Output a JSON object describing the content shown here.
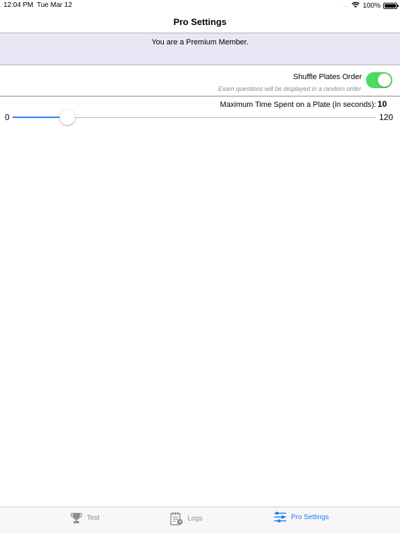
{
  "status_bar": {
    "time": "12:04 PM",
    "date": "Tue Mar 12",
    "battery_percent": "100%",
    "battery_level": 1.0
  },
  "nav": {
    "title": "Pro Settings"
  },
  "premium": {
    "message": "You are a Premium Member."
  },
  "shuffle": {
    "label": "Shuffle Plates Order",
    "hint": "Exam questions will be displayed in a random order",
    "enabled": true
  },
  "time_slider": {
    "label": "Maximum Time Spent on a Plate (in seconds):",
    "value": "10",
    "min": "0",
    "max": "120"
  },
  "tabs": [
    {
      "label": "Test",
      "icon": "trophy-icon",
      "active": false
    },
    {
      "label": "Logs",
      "icon": "logs-icon",
      "active": false
    },
    {
      "label": "Pro Settings",
      "icon": "sliders-icon",
      "active": true
    }
  ],
  "colors": {
    "accent": "#1e7cf2",
    "toggle_on": "#4cd964",
    "banner_bg": "#e8e7f5",
    "tab_inactive": "#8e8e93"
  }
}
